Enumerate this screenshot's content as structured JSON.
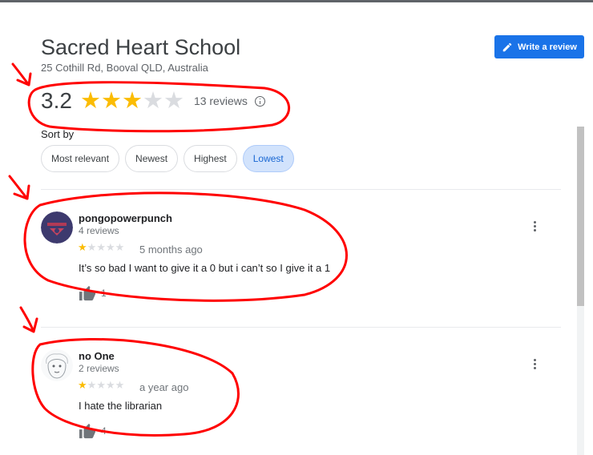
{
  "place": {
    "name": "Sacred Heart School",
    "address": "25 Cothill Rd, Booval QLD, Australia"
  },
  "write_review_label": "Write a review",
  "rating": {
    "value": "3.2",
    "stars": 3,
    "max_stars": 5,
    "count_text": "13 reviews"
  },
  "sort": {
    "label": "Sort by",
    "options": [
      "Most relevant",
      "Newest",
      "Highest",
      "Lowest"
    ],
    "selected": "Lowest"
  },
  "reviews": [
    {
      "name": "pongopowerpunch",
      "count": "4 reviews",
      "stars": 1,
      "date": "5 months ago",
      "text": "It’s so bad I want to give it a 0 but i can’t so I give it a 1",
      "likes": "1"
    },
    {
      "name": "no One",
      "count": "2 reviews",
      "stars": 1,
      "date": "a year ago",
      "text": "I hate the librarian",
      "likes": "4"
    }
  ],
  "colors": {
    "accent": "#1a73e8",
    "star_filled": "#fbbc04",
    "star_empty": "#dadce0",
    "annotation": "#ff0000",
    "chip_selected_bg": "#d2e3fc"
  },
  "icons": [
    "pencil-icon",
    "info-icon",
    "thumb-up-icon",
    "more-vert-icon",
    "avatar"
  ]
}
